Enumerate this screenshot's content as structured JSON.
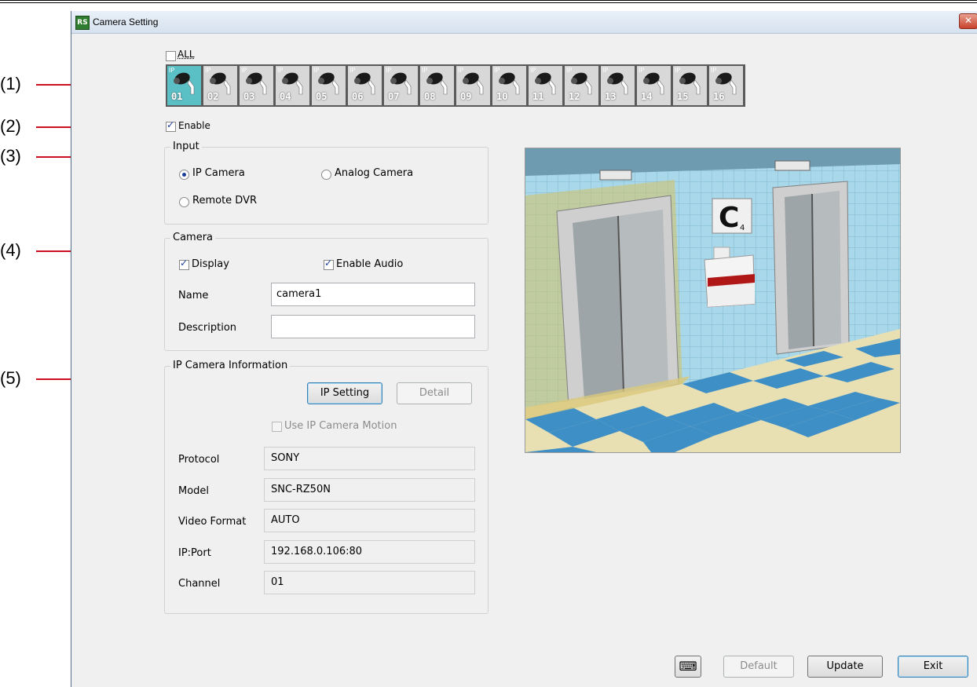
{
  "window": {
    "title": "Camera Setting",
    "close_label": "✕"
  },
  "all_checkbox": {
    "label": "ALL",
    "checked": false
  },
  "camera_strip": {
    "ip_tag": "IP",
    "selected": "01",
    "cameras": [
      "01",
      "02",
      "03",
      "04",
      "05",
      "06",
      "07",
      "08",
      "09",
      "10",
      "11",
      "12",
      "13",
      "14",
      "15",
      "16"
    ]
  },
  "enable": {
    "label": "Enable",
    "checked": true
  },
  "input_group": {
    "title": "Input",
    "options": [
      "IP Camera",
      "Analog Camera",
      "Remote DVR"
    ],
    "selected": "IP Camera"
  },
  "camera_group": {
    "title": "Camera",
    "display_label": "Display",
    "display_checked": true,
    "enable_audio_label": "Enable Audio",
    "enable_audio_checked": true,
    "name_label": "Name",
    "name_value": "camera1",
    "description_label": "Description",
    "description_value": ""
  },
  "ipcam_group": {
    "title": "IP Camera Information",
    "ip_setting_label": "IP Setting",
    "detail_label": "Detail",
    "use_motion_label": "Use IP Camera Motion",
    "use_motion_checked": false,
    "fields": [
      {
        "label": "Protocol",
        "value": "SONY"
      },
      {
        "label": "Model",
        "value": "SNC-RZ50N"
      },
      {
        "label": "Video Format",
        "value": "AUTO"
      },
      {
        "label": "IP:Port",
        "value": "192.168.0.106:80"
      },
      {
        "label": "Channel",
        "value": "01"
      }
    ]
  },
  "callouts": [
    "(1)",
    "(2)",
    "(3)",
    "(4)",
    "(5)"
  ],
  "preview": {
    "sign_letter": "C",
    "sign_sub": "4"
  },
  "footer": {
    "default_label": "Default",
    "update_label": "Update",
    "exit_label": "Exit"
  },
  "icons": {
    "keyboard": "keyboard-icon",
    "camera": "camera-icon"
  },
  "colors": {
    "callout_line": "#cc1020",
    "selected_camera": "#5bc0c6",
    "titlebar": "#dce6f1"
  }
}
